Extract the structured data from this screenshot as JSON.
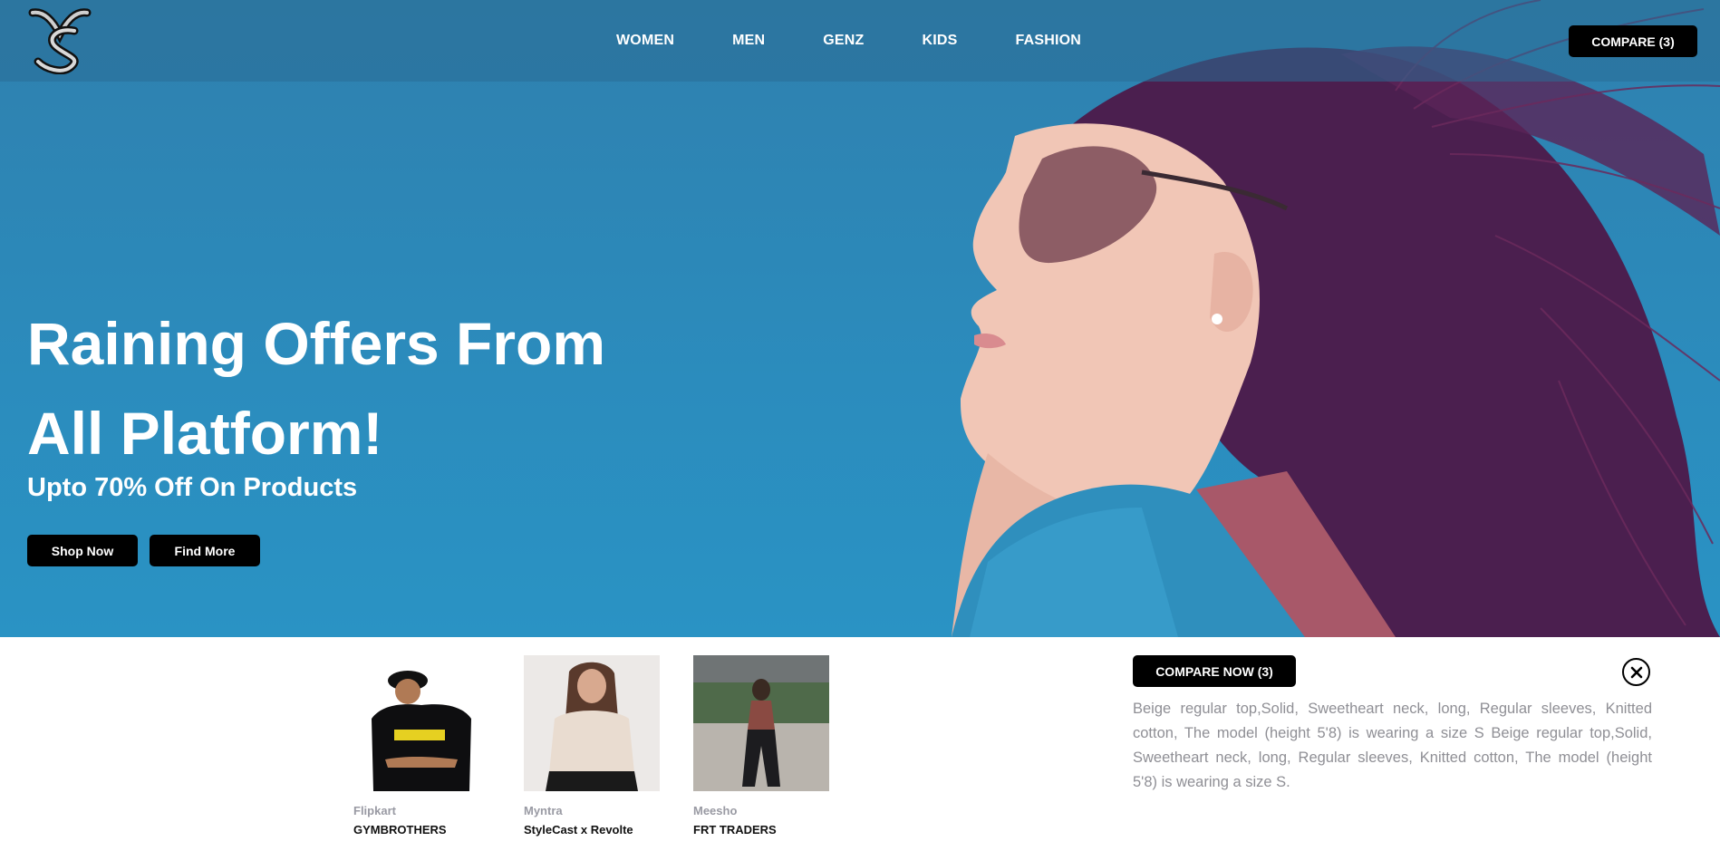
{
  "header": {
    "logo_icon": "interlocked-ys-monogram-logo",
    "nav": [
      "WOMEN",
      "MEN",
      "GENZ",
      "KIDS",
      "FASHION"
    ],
    "compare_button": "COMPARE (3)"
  },
  "hero": {
    "headline": "Raining Offers From All Platform!",
    "subheadline": "Upto 70% Off On Products",
    "buttons": {
      "shop_now": "Shop Now",
      "find_more": "Find More"
    },
    "background_color": "#2b8cbd"
  },
  "compare_panel": {
    "products": [
      {
        "platform": "Flipkart",
        "seller": "GYMBROTHERS"
      },
      {
        "platform": "Myntra",
        "seller": "StyleCast x Revolte"
      },
      {
        "platform": "Meesho",
        "seller": "FRT TRADERS"
      }
    ],
    "compare_now_button": "COMPARE NOW (3)",
    "close_icon": "close-circle-icon",
    "description": "Beige regular top,Solid, Sweetheart neck, long, Regular sleeves, Knitted cotton, The model (height 5'8) is wearing a size S Beige regular top,Solid, Sweetheart neck, long, Regular sleeves, Knitted cotton, The model (height 5'8) is wearing a size S."
  }
}
